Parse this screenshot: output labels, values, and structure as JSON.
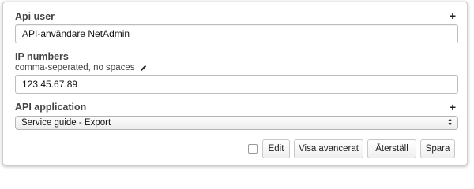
{
  "api_user": {
    "label": "Api user",
    "add_icon": "plus-icon",
    "value": "API-användare NetAdmin"
  },
  "ip_numbers": {
    "label": "IP numbers",
    "hint": "comma-seperated, no spaces",
    "edit_icon": "pencil-icon",
    "value": "123.45.67.89"
  },
  "api_application": {
    "label": "API application",
    "add_icon": "plus-icon",
    "selected": "Service guide - Export"
  },
  "footer": {
    "edit_checkbox_checked": false,
    "edit_label": "Edit",
    "advanced_label": "Visa avancerat",
    "reset_label": "Återställ",
    "save_label": "Spara"
  }
}
